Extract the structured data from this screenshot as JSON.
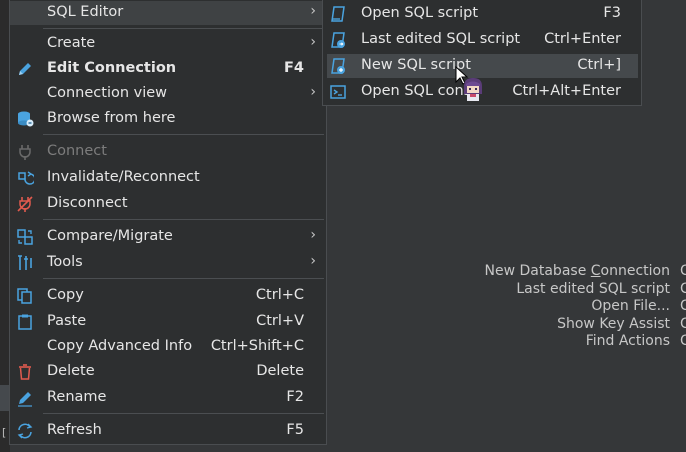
{
  "context_menu": {
    "items": [
      {
        "label": "SQL Editor",
        "shortcut": "",
        "submenu": true,
        "icon": "none"
      },
      {
        "label": "Create",
        "shortcut": "",
        "submenu": true,
        "icon": "none"
      },
      {
        "label": "Edit Connection",
        "shortcut": "F4",
        "submenu": false,
        "icon": "pencil-icon"
      },
      {
        "label": "Connection view",
        "shortcut": "",
        "submenu": true,
        "icon": "none"
      },
      {
        "label": "Browse from here",
        "shortcut": "",
        "submenu": false,
        "icon": "database-icon"
      },
      {
        "label": "Connect",
        "shortcut": "",
        "submenu": false,
        "icon": "plug-icon",
        "disabled": true
      },
      {
        "label": "Invalidate/Reconnect",
        "shortcut": "",
        "submenu": false,
        "icon": "reconnect-icon"
      },
      {
        "label": "Disconnect",
        "shortcut": "",
        "submenu": false,
        "icon": "disconnect-icon"
      },
      {
        "label": "Compare/Migrate",
        "shortcut": "",
        "submenu": true,
        "icon": "compare-icon"
      },
      {
        "label": "Tools",
        "shortcut": "",
        "submenu": true,
        "icon": "tools-icon"
      },
      {
        "label": "Copy",
        "shortcut": "Ctrl+C",
        "submenu": false,
        "icon": "copy-icon"
      },
      {
        "label": "Paste",
        "shortcut": "Ctrl+V",
        "submenu": false,
        "icon": "paste-icon"
      },
      {
        "label": "Copy Advanced Info",
        "shortcut": "Ctrl+Shift+C",
        "submenu": false,
        "icon": "none"
      },
      {
        "label": "Delete",
        "shortcut": "Delete",
        "submenu": false,
        "icon": "trash-icon"
      },
      {
        "label": "Rename",
        "shortcut": "F2",
        "submenu": false,
        "icon": "rename-icon"
      },
      {
        "label": "Refresh",
        "shortcut": "F5",
        "submenu": false,
        "icon": "refresh-icon"
      }
    ],
    "arrow_glyph": "›"
  },
  "sql_editor_submenu": {
    "items": [
      {
        "label": "Open SQL script",
        "shortcut": "F3",
        "icon": "sql-script-icon"
      },
      {
        "label": "Last edited SQL script",
        "shortcut": "Ctrl+Enter",
        "icon": "sql-script-recent-icon"
      },
      {
        "label": "New SQL script",
        "shortcut": "Ctrl+]",
        "icon": "sql-script-new-icon",
        "highlighted": true
      },
      {
        "label": "Open SQL cons",
        "shortcut": "Ctrl+Alt+Enter",
        "icon": "sql-console-icon"
      }
    ]
  },
  "welcome_hints": {
    "items": [
      {
        "pre": "New Database ",
        "mnemonic": "C",
        "post": "onnection"
      },
      {
        "pre": "Last edited SQL script",
        "mnemonic": "",
        "post": ""
      },
      {
        "pre": "Open File...",
        "mnemonic": "",
        "post": ""
      },
      {
        "pre": "Show Key Assist",
        "mnemonic": "",
        "post": ""
      },
      {
        "pre": "Find Actions",
        "mnemonic": "",
        "post": ""
      }
    ],
    "tail": [
      "C",
      "C",
      "C",
      "C",
      "C"
    ]
  },
  "left_panel": {
    "bracket": "["
  },
  "colors": {
    "accent_blue": "#4aa3df",
    "danger_red": "#e05a4e",
    "menu_bg": "#2d2f30",
    "workspace_bg": "#353739"
  }
}
